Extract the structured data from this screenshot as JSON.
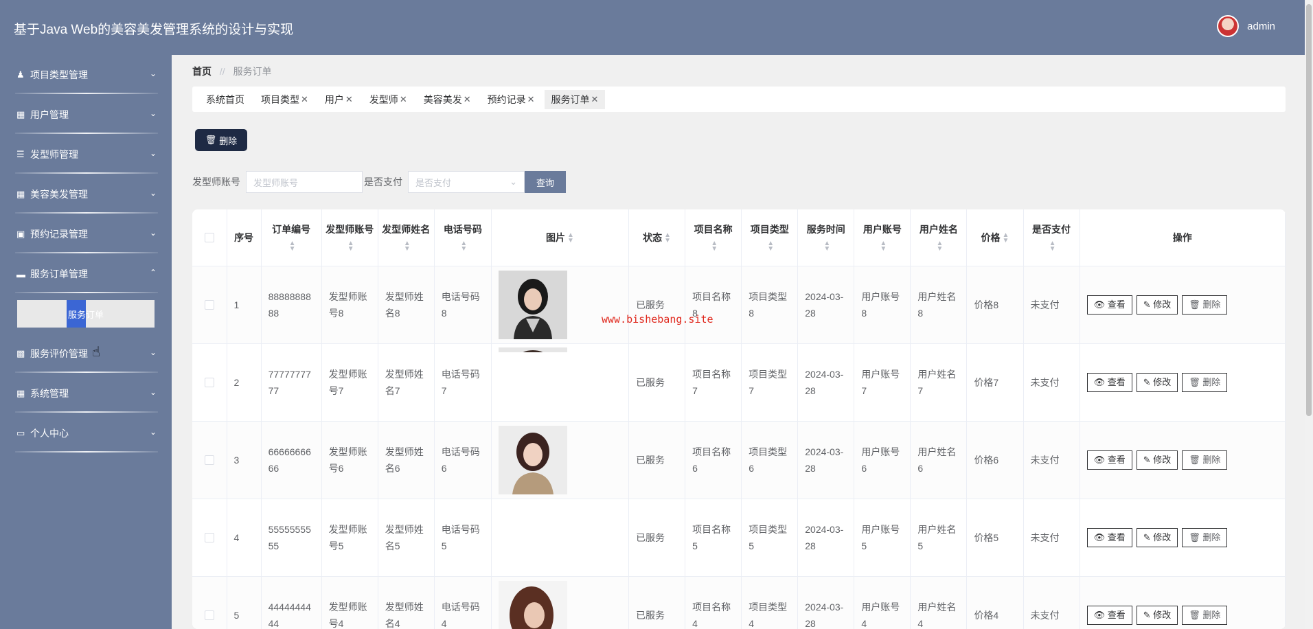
{
  "header": {
    "title": "基于Java Web的美容美发管理系统的设计与实现",
    "user": "admin"
  },
  "sidebar": {
    "items": [
      {
        "label": "项目类型管理",
        "icon": "user-icon"
      },
      {
        "label": "用户管理",
        "icon": "grid-icon"
      },
      {
        "label": "发型师管理",
        "icon": "list-icon"
      },
      {
        "label": "美容美发管理",
        "icon": "grid-icon"
      },
      {
        "label": "预约记录管理",
        "icon": "briefcase-icon"
      },
      {
        "label": "服务订单管理",
        "icon": "ticket-icon"
      },
      {
        "label": "服务评价管理",
        "icon": "chart-icon"
      },
      {
        "label": "系统管理",
        "icon": "grid-icon"
      },
      {
        "label": "个人中心",
        "icon": "card-icon"
      }
    ],
    "active_sub": "服务订单"
  },
  "breadcrumb": {
    "home": "首页",
    "sep": "//",
    "current": "服务订单"
  },
  "tabs": [
    "系统首页",
    "项目类型",
    "用户",
    "发型师",
    "美容美发",
    "预约记录",
    "服务订单"
  ],
  "toolbar": {
    "delete_label": "删除"
  },
  "search": {
    "field1_label": "发型师账号",
    "field1_placeholder": "发型师账号",
    "field2_label": "是否支付",
    "field2_placeholder": "是否支付",
    "query_label": "查询"
  },
  "table": {
    "headers": {
      "index": "序号",
      "order_no": "订单编号",
      "stylist_account": "发型师账号",
      "stylist_name": "发型师姓名",
      "phone": "电话号码",
      "image": "图片",
      "status": "状态",
      "item_name": "项目名称",
      "item_type": "项目类型",
      "service_time": "服务时间",
      "user_account": "用户账号",
      "user_name": "用户姓名",
      "price": "价格",
      "paid": "是否支付",
      "actions": "操作"
    },
    "rows": [
      {
        "index": "1",
        "order_no": "8888888888",
        "stylist_account": "发型师账号8",
        "stylist_name": "发型师姓名8",
        "phone": "电话号码8",
        "status": "已服务",
        "item_name": "项目名称8",
        "item_type": "项目类型8",
        "service_time": "2024-03-28",
        "user_account": "用户账号8",
        "user_name": "用户姓名8",
        "price": "价格8",
        "paid": "未支付"
      },
      {
        "index": "2",
        "order_no": "7777777777",
        "stylist_account": "发型师账号7",
        "stylist_name": "发型师姓名7",
        "phone": "电话号码7",
        "status": "已服务",
        "item_name": "项目名称7",
        "item_type": "项目类型7",
        "service_time": "2024-03-28",
        "user_account": "用户账号7",
        "user_name": "用户姓名7",
        "price": "价格7",
        "paid": "未支付"
      },
      {
        "index": "3",
        "order_no": "6666666666",
        "stylist_account": "发型师账号6",
        "stylist_name": "发型师姓名6",
        "phone": "电话号码6",
        "status": "已服务",
        "item_name": "项目名称6",
        "item_type": "项目类型6",
        "service_time": "2024-03-28",
        "user_account": "用户账号6",
        "user_name": "用户姓名6",
        "price": "价格6",
        "paid": "未支付"
      },
      {
        "index": "4",
        "order_no": "5555555555",
        "stylist_account": "发型师账号5",
        "stylist_name": "发型师姓名5",
        "phone": "电话号码5",
        "status": "已服务",
        "item_name": "项目名称5",
        "item_type": "项目类型5",
        "service_time": "2024-03-28",
        "user_account": "用户账号5",
        "user_name": "用户姓名5",
        "price": "价格5",
        "paid": "未支付"
      },
      {
        "index": "5",
        "order_no": "4444444444",
        "stylist_account": "发型师账号4",
        "stylist_name": "发型师姓名4",
        "phone": "电话号码4",
        "status": "已服务",
        "item_name": "项目名称4",
        "item_type": "项目类型4",
        "service_time": "2024-03-28",
        "user_account": "用户账号4",
        "user_name": "用户姓名4",
        "price": "价格4",
        "paid": "未支付"
      }
    ],
    "actions": {
      "view": "查看",
      "edit": "修改",
      "delete": "删除"
    }
  },
  "watermark": "www.bishebang.site",
  "colors": {
    "nav_bg": "#6a7b9b",
    "delete_btn": "#1e2a44",
    "active_sub": "#3b66d4"
  }
}
